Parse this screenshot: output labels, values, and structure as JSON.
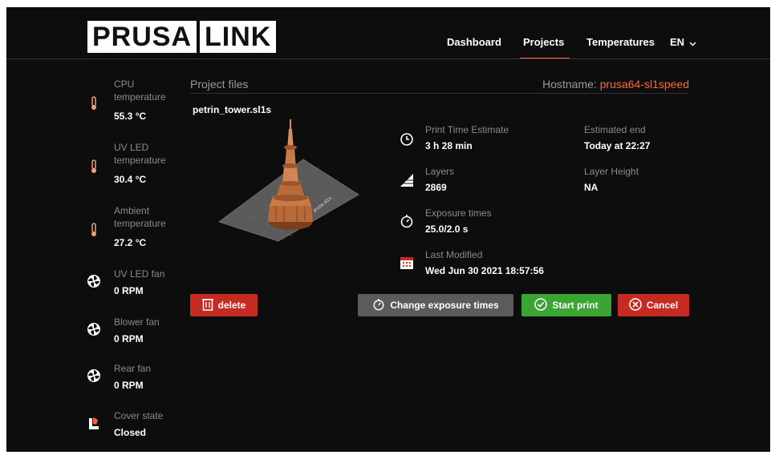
{
  "header": {
    "logo_left": "PRUSA",
    "logo_right": "LINK",
    "nav": [
      {
        "label": "Dashboard"
      },
      {
        "label": "Projects",
        "active": true
      },
      {
        "label": "Temperatures"
      }
    ],
    "language": "EN"
  },
  "sidebar": {
    "sensors": [
      {
        "label": "CPU temperature",
        "value": "55.3 °C",
        "icon": "thermometer-icon"
      },
      {
        "label": "UV LED temperature",
        "value": "30.4 °C",
        "icon": "thermometer-icon"
      },
      {
        "label": "Ambient temperature",
        "value": "27.2 °C",
        "icon": "thermometer-icon"
      },
      {
        "label": "UV LED fan",
        "value": "0 RPM",
        "icon": "fan-icon"
      },
      {
        "label": "Blower fan",
        "value": "0 RPM",
        "icon": "fan-icon"
      },
      {
        "label": "Rear fan",
        "value": "0 RPM",
        "icon": "fan-icon"
      },
      {
        "label": "Cover state",
        "value": "Closed",
        "icon": "cover-icon"
      }
    ]
  },
  "main": {
    "section_title": "Project files",
    "hostname_label": "Hostname:",
    "hostname_value": "prusa64-sl1speed",
    "filename": "petrin_tower.sl1s",
    "preview_plate_text": "prusa sl1s",
    "details": {
      "print_time_label": "Print Time Estimate",
      "print_time_value": "3 h 28 min",
      "estimated_end_label": "Estimated end",
      "estimated_end_value": "Today at 22:27",
      "layers_label": "Layers",
      "layers_value": "2869",
      "layer_height_label": "Layer Height",
      "layer_height_value": "NA",
      "exposure_label": "Exposure times",
      "exposure_value": "25.0/2.0 s",
      "modified_label": "Last Modified",
      "modified_value": "Wed Jun 30 2021 18:57:56"
    },
    "buttons": {
      "delete": "delete",
      "change_exposure": "Change exposure times",
      "start": "Start print",
      "cancel": "Cancel"
    }
  },
  "colors": {
    "accent": "#fa6831",
    "background": "#0d0d0d",
    "danger": "#c62b22",
    "success": "#3aa532",
    "neutral_button": "#5b5b5b"
  }
}
